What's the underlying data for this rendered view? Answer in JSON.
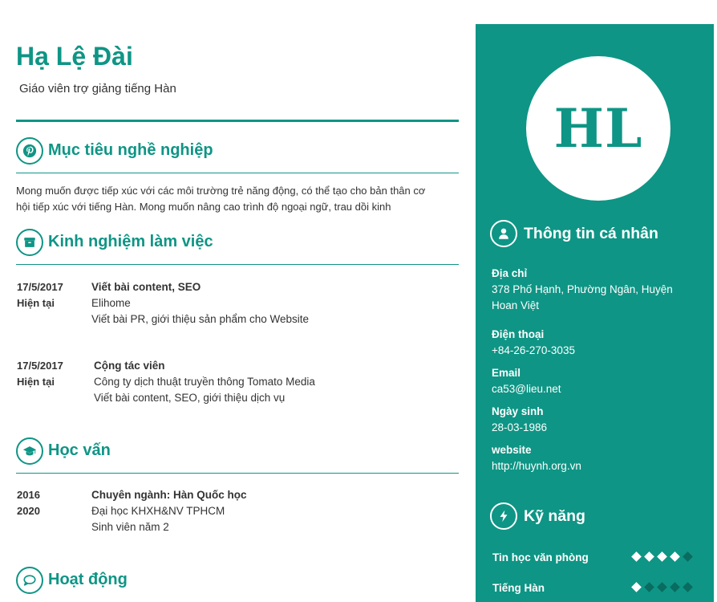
{
  "profile": {
    "name": "Hạ Lệ Đài",
    "position": "Giáo viên trợ giảng tiếng Hàn",
    "initials": "HL"
  },
  "sections": {
    "objective": {
      "title": "Mục tiêu nghề nghiệp",
      "icon": "pinterest-icon",
      "lines": [
        "Mong muốn được tiếp xúc với các môi trường trẻ năng động, có thể tạo cho bản thân cơ",
        "hội tiếp xúc với tiếng Hàn. Mong muốn nâng cao trình độ ngoại ngữ, trau dồi kinh"
      ]
    },
    "experience": {
      "title": "Kinh nghiệm làm việc",
      "icon": "archive-icon",
      "items": [
        {
          "start": "17/5/2017",
          "end": "Hiện tại",
          "title": "Viết bài content, SEO",
          "company": "Elihome",
          "description": "Viết bài PR, giới thiệu sản phẩm cho Website"
        },
        {
          "start": "17/5/2017",
          "end": "Hiện tại",
          "title": "Cộng tác viên",
          "company": "Công ty dịch thuật truyền thông Tomato Media",
          "description": "Viết bài content, SEO, giới thiệu dịch vụ"
        }
      ]
    },
    "education": {
      "title": "Học vấn",
      "icon": "graduation-cap-icon",
      "items": [
        {
          "start": "2016",
          "end": "2020",
          "major": "Chuyên ngành: Hàn Quốc học",
          "school": "Đại học KHXH&NV TPHCM",
          "note": "Sinh viên năm 2"
        }
      ]
    },
    "activities": {
      "title": "Hoạt động",
      "icon": "speech-bubble-icon"
    }
  },
  "personal": {
    "title": "Thông tin cá nhân",
    "icon": "user-icon",
    "address_label": "Địa chỉ",
    "address_lines": [
      "378 Phố Hạnh, Phường Ngân, Huyện",
      "Hoan Việt"
    ],
    "phone_label": "Điện thoại",
    "phone": "+84-26-270-3035",
    "email_label": "Email",
    "email": "ca53@lieu.net",
    "birthday_label": "Ngày sinh",
    "birthday": "28-03-1986",
    "website_label": "website",
    "website": "http://huynh.org.vn"
  },
  "skills": {
    "title": "Kỹ năng",
    "icon": "lightning-icon",
    "max_level": 5,
    "items": [
      {
        "name": "Tin học văn phòng",
        "level": 4
      },
      {
        "name": "Tiếng Hàn",
        "level": 1
      }
    ]
  },
  "colors": {
    "accent": "#0e9585",
    "dot_empty": "#0a6b60",
    "text": "#333333",
    "white": "#ffffff"
  }
}
